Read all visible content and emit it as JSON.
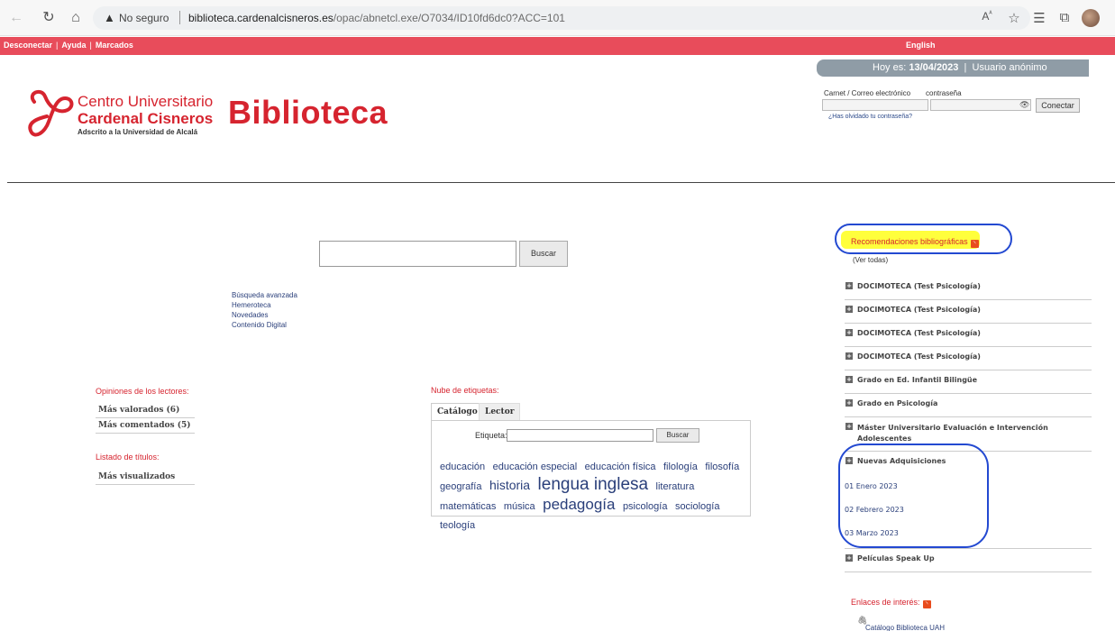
{
  "browser": {
    "security": "No seguro",
    "url_host": "biblioteca.cardenalcisneros.es",
    "url_path": "/opac/abnetcl.exe/O7034/ID10fd6dc0?ACC=101"
  },
  "topbar": {
    "disconnect": "Desconectar",
    "help": "Ayuda",
    "bookmarks": "Marcados",
    "language": "English"
  },
  "datebar": {
    "today_label": "Hoy es:",
    "date": "13/04/2023",
    "user": "Usuario anónimo"
  },
  "login": {
    "user_label": "Carnet / Correo electrónico",
    "password_label": "contraseña",
    "connect": "Conectar",
    "forgot": "¿Has olvidado tu contraseña?"
  },
  "logo": {
    "line1": "Centro Universitario",
    "line2": "Cardenal Cisneros",
    "line3": "Adscrito a la Universidad de Alcalá",
    "title": "Biblioteca"
  },
  "search": {
    "button": "Buscar",
    "links": [
      "Búsqueda avanzada",
      "Hemeroteca",
      "Novedades",
      "Contenido Digital"
    ]
  },
  "opinions": {
    "title": "Opiniones de los lectores:",
    "items": [
      "Más valorados (6)",
      "Más comentados (5)"
    ]
  },
  "titles_list": {
    "title": "Listado de títulos:",
    "items": [
      "Más visualizados"
    ]
  },
  "tag_cloud": {
    "title": "Nube de etiquetas:",
    "tabs": [
      "Catálogo",
      "Lector"
    ],
    "tag_label": "Etiqueta:",
    "button": "Buscar",
    "tags": [
      {
        "text": "educación",
        "size": 1
      },
      {
        "text": "educación especial",
        "size": 1
      },
      {
        "text": "educación física",
        "size": 1
      },
      {
        "text": "filología",
        "size": 2
      },
      {
        "text": "filosofía",
        "size": 2
      },
      {
        "text": "geografía",
        "size": 1
      },
      {
        "text": "historia",
        "size": 3
      },
      {
        "text": "lengua inglesa",
        "size": 5
      },
      {
        "text": "literatura",
        "size": 2
      },
      {
        "text": "matemáticas",
        "size": 2
      },
      {
        "text": "música",
        "size": 1
      },
      {
        "text": "pedagogía",
        "size": 4
      },
      {
        "text": "psicología",
        "size": 2
      },
      {
        "text": "sociología",
        "size": 1
      },
      {
        "text": "teología",
        "size": 2
      }
    ]
  },
  "recommendations": {
    "title": "Recomendaciones bibliográficas",
    "see_all": "(Ver todas)",
    "items": [
      "DOCIMOTECA (Test Psicología)",
      "DOCIMOTECA (Test Psicología)",
      "DOCIMOTECA (Test Psicología)",
      "DOCIMOTECA (Test Psicología)",
      "Grado en Ed. Infantil Bilingüe",
      "Grado en Psicología",
      "Máster Universitario Evaluación e Intervención Adolescentes",
      "Nuevas Adquisiciones"
    ],
    "sub_items": [
      "01 Enero 2023",
      "02 Febrero 2023",
      "03 Marzo 2023"
    ],
    "last_item": "Películas Speak Up"
  },
  "links_of_interest": {
    "title": "Enlaces de interés:",
    "first_link": "Catálogo Biblioteca UAH"
  },
  "colors": {
    "brand_red": "#d6242f",
    "topbar_red": "#e84c5b",
    "annotation_blue": "#2349d1",
    "highlight_yellow": "#ffff3c"
  }
}
